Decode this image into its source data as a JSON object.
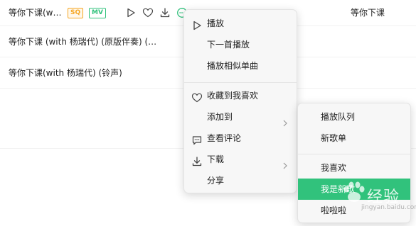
{
  "song_list": {
    "rows": [
      {
        "title": "等你下课(w…",
        "badges": [
          "SQ",
          "MV"
        ],
        "artist": "等你下课"
      },
      {
        "title": "等你下课 (with 杨瑞代) (原版伴奏) (…"
      },
      {
        "title": "等你下课(with 杨瑞代) (铃声)"
      }
    ],
    "row_icons": [
      "play-icon",
      "heart-icon",
      "download-icon",
      "more-icon"
    ]
  },
  "context_menu": {
    "items": [
      {
        "label": "播放",
        "icon": "play-icon"
      },
      {
        "label": "下一首播放"
      },
      {
        "label": "播放相似单曲"
      },
      {
        "label": "收藏到我喜欢",
        "icon": "heart-icon"
      },
      {
        "label": "添加到",
        "submenu": true
      },
      {
        "label": "查看评论",
        "icon": "comment-icon"
      },
      {
        "label": "下载",
        "icon": "download-icon",
        "submenu": true
      },
      {
        "label": "分享"
      }
    ]
  },
  "add_to_submenu": {
    "items": [
      {
        "label": "播放队列"
      },
      {
        "label": "新歌单"
      },
      {
        "label": "我喜欢"
      },
      {
        "label": "我是新歌",
        "highlighted": true
      },
      {
        "label": "啦啦啦"
      }
    ]
  },
  "watermark": {
    "text": "经验",
    "sub": "jingyan.baidu.com"
  },
  "colors": {
    "accent": "#31c27c",
    "sq_badge": "#f5a623"
  }
}
